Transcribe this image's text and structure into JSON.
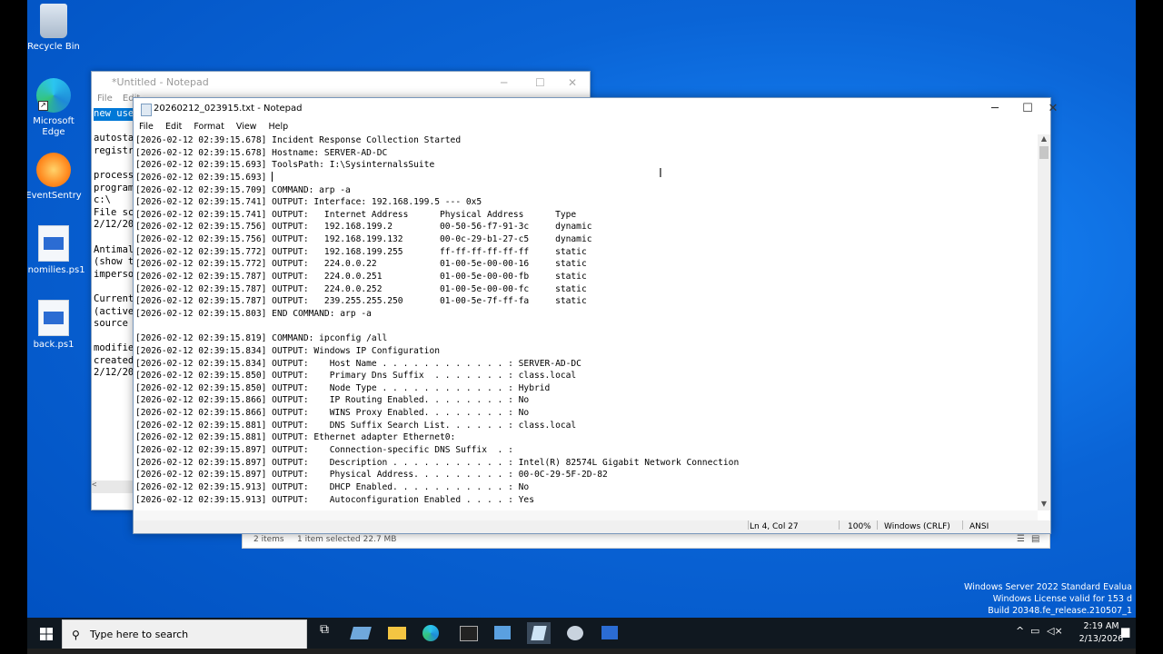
{
  "desktop_icons": [
    {
      "label": "Recycle Bin",
      "icon": "recycle-bin-icon"
    },
    {
      "label": "Microsoft Edge",
      "icon": "edge-icon"
    },
    {
      "label": "EventSentry",
      "icon": "eventsentry-icon"
    },
    {
      "label": "anomilies.ps1",
      "icon": "powershell-script-icon"
    },
    {
      "label": "back.ps1",
      "icon": "powershell-script-icon"
    }
  ],
  "back_notepad": {
    "title": "*Untitled - Notepad",
    "menu": [
      "File",
      "Edit"
    ],
    "lines": [
      "new use",
      "",
      "autosta",
      "registr",
      "",
      "process",
      "program",
      "c:\\",
      "File sc",
      "2/12/20",
      "",
      "Antimal",
      "(show t",
      "imperso",
      "",
      "Current",
      "(active",
      "source",
      "",
      "modifie",
      "created",
      "2/12/20"
    ]
  },
  "explorer_status": {
    "items": "2 items",
    "selected": "1 item selected  22.7 MB"
  },
  "front_notepad": {
    "title": "20260212_023915.txt - Notepad",
    "menu": [
      "File",
      "Edit",
      "Format",
      "View",
      "Help"
    ],
    "lines": [
      "[2026-02-12 02:39:15.678] Incident Response Collection Started",
      "[2026-02-12 02:39:15.678] Hostname: SERVER-AD-DC",
      "[2026-02-12 02:39:15.693] ToolsPath: I:\\SysinternalsSuite",
      "[2026-02-12 02:39:15.693] ",
      "[2026-02-12 02:39:15.709] COMMAND: arp -a",
      "[2026-02-12 02:39:15.741] OUTPUT: Interface: 192.168.199.5 --- 0x5",
      "[2026-02-12 02:39:15.741] OUTPUT:   Internet Address      Physical Address      Type",
      "[2026-02-12 02:39:15.756] OUTPUT:   192.168.199.2         00-50-56-f7-91-3c     dynamic",
      "[2026-02-12 02:39:15.756] OUTPUT:   192.168.199.132       00-0c-29-b1-27-c5     dynamic",
      "[2026-02-12 02:39:15.772] OUTPUT:   192.168.199.255       ff-ff-ff-ff-ff-ff     static",
      "[2026-02-12 02:39:15.772] OUTPUT:   224.0.0.22            01-00-5e-00-00-16     static",
      "[2026-02-12 02:39:15.787] OUTPUT:   224.0.0.251           01-00-5e-00-00-fb     static",
      "[2026-02-12 02:39:15.787] OUTPUT:   224.0.0.252           01-00-5e-00-00-fc     static",
      "[2026-02-12 02:39:15.787] OUTPUT:   239.255.255.250       01-00-5e-7f-ff-fa     static",
      "[2026-02-12 02:39:15.803] END COMMAND: arp -a",
      "",
      "[2026-02-12 02:39:15.819] COMMAND: ipconfig /all",
      "[2026-02-12 02:39:15.834] OUTPUT: Windows IP Configuration",
      "[2026-02-12 02:39:15.834] OUTPUT:    Host Name . . . . . . . . . . . . : SERVER-AD-DC",
      "[2026-02-12 02:39:15.850] OUTPUT:    Primary Dns Suffix  . . . . . . . : class.local",
      "[2026-02-12 02:39:15.850] OUTPUT:    Node Type . . . . . . . . . . . . : Hybrid",
      "[2026-02-12 02:39:15.866] OUTPUT:    IP Routing Enabled. . . . . . . . : No",
      "[2026-02-12 02:39:15.866] OUTPUT:    WINS Proxy Enabled. . . . . . . . : No",
      "[2026-02-12 02:39:15.881] OUTPUT:    DNS Suffix Search List. . . . . . : class.local",
      "[2026-02-12 02:39:15.881] OUTPUT: Ethernet adapter Ethernet0:",
      "[2026-02-12 02:39:15.897] OUTPUT:    Connection-specific DNS Suffix  . :",
      "[2026-02-12 02:39:15.897] OUTPUT:    Description . . . . . . . . . . . : Intel(R) 82574L Gigabit Network Connection",
      "[2026-02-12 02:39:15.897] OUTPUT:    Physical Address. . . . . . . . . : 00-0C-29-5F-2D-82",
      "[2026-02-12 02:39:15.913] OUTPUT:    DHCP Enabled. . . . . . . . . . . : No",
      "[2026-02-12 02:39:15.913] OUTPUT:    Autoconfiguration Enabled . . . . : Yes"
    ],
    "status": {
      "position": "Ln 4, Col 27",
      "zoom": "100%",
      "line_ending": "Windows (CRLF)",
      "encoding": "ANSI"
    }
  },
  "watermark": [
    "Windows Server 2022 Standard Evalua",
    "Windows License valid for 153 d",
    "Build 20348.fe_release.210507_1"
  ],
  "taskbar": {
    "search_placeholder": "Type here to search",
    "time": "2:19 AM",
    "date": "2/13/2026"
  },
  "colors": {
    "desktop": "#0a64d6",
    "taskbar": "#101820",
    "selection": "#0078d7"
  }
}
